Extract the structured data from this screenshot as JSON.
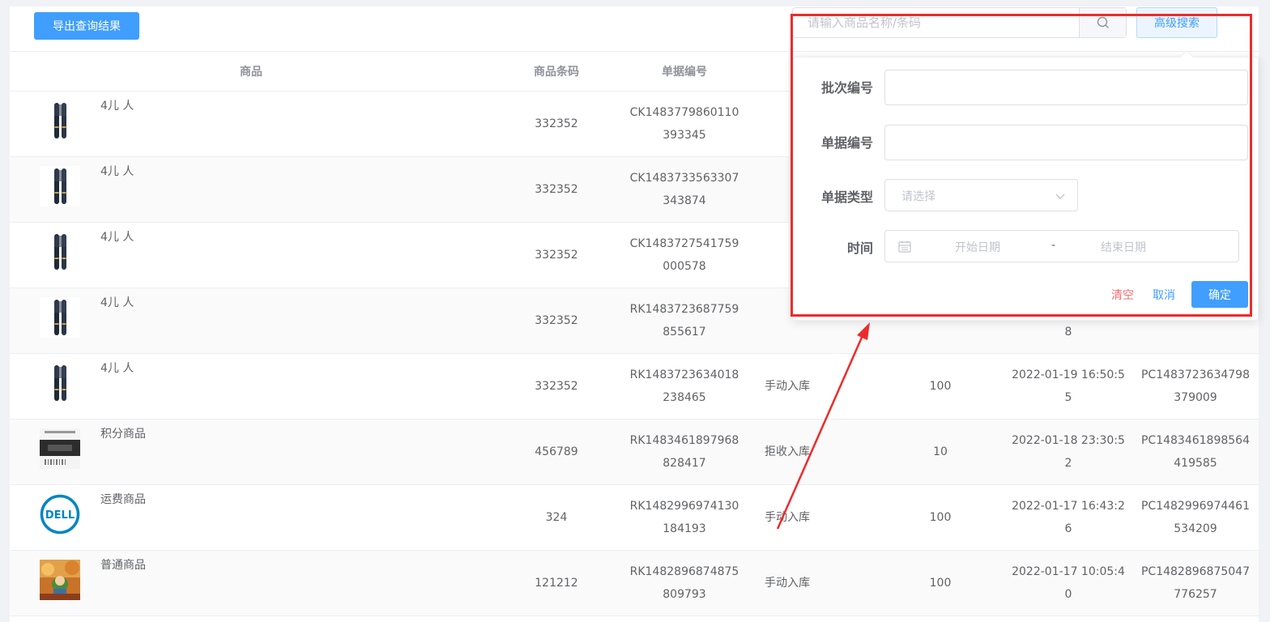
{
  "toolbar": {
    "export_label": "导出查询结果",
    "search_placeholder": "请输入商品名称/条码",
    "advanced_label": "高级搜索"
  },
  "table": {
    "columns": [
      "商品",
      "商品条码",
      "单据编号",
      "",
      "",
      "",
      ""
    ],
    "rows": [
      {
        "name": "4儿 人",
        "barcode": "332352",
        "doc_no_1": "CK1483779860110",
        "doc_no_2": "393345",
        "type": "",
        "qty": "",
        "time_1": "",
        "time_2": "",
        "batch_1": "",
        "batch_2": "",
        "thumb": "brush"
      },
      {
        "name": "4儿 人",
        "barcode": "332352",
        "doc_no_1": "CK1483733563307",
        "doc_no_2": "343874",
        "type": "",
        "qty": "",
        "time_1": "",
        "time_2": "",
        "batch_1": "",
        "batch_2": "",
        "thumb": "brush"
      },
      {
        "name": "4儿 人",
        "barcode": "332352",
        "doc_no_1": "CK1483727541759",
        "doc_no_2": "000578",
        "type": "",
        "qty": "",
        "time_1": "",
        "time_2": "",
        "batch_1": "",
        "batch_2": "",
        "thumb": "brush"
      },
      {
        "name": "4儿 人",
        "barcode": "332352",
        "doc_no_1": "RK1483723687759",
        "doc_no_2": "855617",
        "type": "",
        "qty": "",
        "time_1": "",
        "time_2": "8",
        "batch_1": "",
        "batch_2": "",
        "thumb": "brush"
      },
      {
        "name": "4儿 人",
        "barcode": "332352",
        "doc_no_1": "RK1483723634018",
        "doc_no_2": "238465",
        "type": "手动入库",
        "qty": "100",
        "time_1": "2022-01-19 16:50:5",
        "time_2": "5",
        "batch_1": "PC1483723634798",
        "batch_2": "379009",
        "thumb": "brush"
      },
      {
        "name": "积分商品",
        "barcode": "456789",
        "doc_no_1": "RK1483461897968",
        "doc_no_2": "828417",
        "type": "拒收入库",
        "qty": "10",
        "time_1": "2022-01-18 23:30:5",
        "time_2": "2",
        "batch_1": "PC1483461898564",
        "batch_2": "419585",
        "thumb": "barcode"
      },
      {
        "name": "运费商品",
        "barcode": "324",
        "doc_no_1": "RK1482996974130",
        "doc_no_2": "184193",
        "type": "手动入库",
        "qty": "100",
        "time_1": "2022-01-17 16:43:2",
        "time_2": "6",
        "batch_1": "PC1482996974461",
        "batch_2": "534209",
        "thumb": "dell"
      },
      {
        "name": "普通商品",
        "barcode": "121212",
        "doc_no_1": "RK1482896874875",
        "doc_no_2": "809793",
        "type": "手动入库",
        "qty": "100",
        "time_1": "2022-01-17 10:05:4",
        "time_2": "0",
        "batch_1": "PC1482896875047",
        "batch_2": "776257",
        "thumb": "photo"
      }
    ]
  },
  "thumb_logo_text": "DELL",
  "advanced_form": {
    "batch_label": "批次编号",
    "doc_label": "单据编号",
    "type_label": "单据类型",
    "type_placeholder": "请选择",
    "time_label": "时间",
    "start_placeholder": "开始日期",
    "range_separator": "-",
    "end_placeholder": "结束日期",
    "clear_label": "清空",
    "cancel_label": "取消",
    "ok_label": "确定"
  },
  "colors": {
    "primary": "#409eff",
    "danger": "#f56c6c",
    "annotation": "#ee2b2b"
  }
}
